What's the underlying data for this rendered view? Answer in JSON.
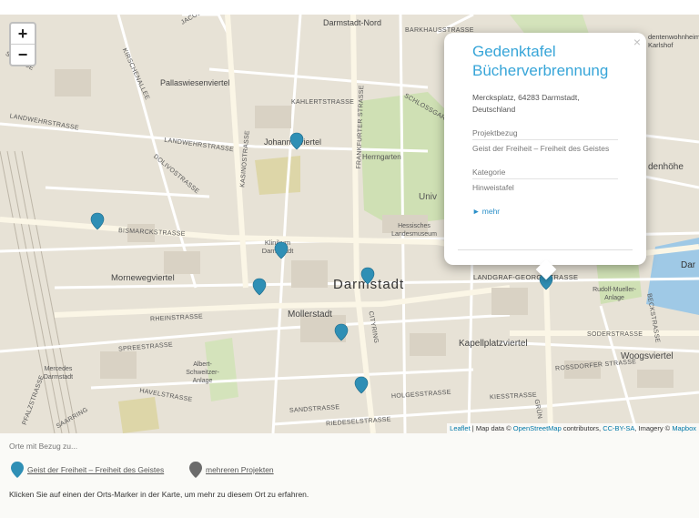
{
  "map": {
    "zoom_in": "+",
    "zoom_out": "−",
    "labels": {
      "darmstadt_nord": "Darmstadt-Nord",
      "barkhausstrasse": "BARKHAUSSTRASSE",
      "pallaswiesenviertel": "Pallaswiesenviertel",
      "kahlertstrasse": "KAHLERTSTRASSE",
      "landwehrstrasse": "LANDWEHRSTRASSE",
      "landwehrstrasse2": "LANDWEHRSTRASSE",
      "dolivostrasse": "DOLIVOSTRASSE",
      "kasinostrasse": "KASINOSTRASSE",
      "johannesviertel": "Johannesviertel",
      "frankfurter": "FRANKFURTER STRASSE",
      "herrngarten": "Herrngarten",
      "schlossgarten": "SCHLOSSGARTEN",
      "univ": "Univ",
      "landesmuseum": "Hessisches Landesmuseum",
      "bismarckstrasse": "BISMARCKSTRASSE",
      "klinikum": "Klinikum Darmstadt",
      "mornewegviertel": "Mornewegviertel",
      "darmstadt": "Darmstadt",
      "rheinstrasse": "RHEINSTRASSE",
      "mollerstadt": "Mollerstadt",
      "citypring": "CITYRING",
      "spreestrasse": "SPREESTRASSE",
      "mercedes": "Mercedes Darmstadt",
      "albert": "Albert-Schweitzer-Anlage",
      "havelstrasse": "HAVELSTRASSE",
      "sandstrasse": "SANDSTRASSE",
      "riedeselstrasse": "RIEDESELSTRASSE",
      "holgesstrasse": "HOLGESSTRASSE",
      "landgraf": "LANDGRAF-GEORG-STRASSE",
      "kapellplatz": "Kapellplatzviertel",
      "soderstrasse": "SODERSTRASSE",
      "woogsviertel": "Woogsviertel",
      "rossdorfer": "ROSSDORFER STRASSE",
      "kiesstrasse": "KIESSTRASSE",
      "rudolf": "Rudolf-Mueller-Anlage",
      "dentenwohnheim": "dentenwohnheim Karlshof",
      "denhoehe": "denhöhe",
      "dar": "Dar",
      "kirschenallee": "KIRSCHENALLEE",
      "pfalzstrasse": "PFALZSTRASSE",
      "jacob": "JACOB",
      "strasse_left": "STRASSE",
      "saarstrasse": "SAARRING",
      "beckstrasse": "BECKSTRASSE",
      "grun": "GRÜN"
    }
  },
  "popup": {
    "close": "×",
    "title": "Gedenktafel Bücherverbrennung",
    "address": "Mercksplatz, 64283 Darmstadt, Deutschland",
    "project_label": "Projektbezug",
    "project_value": "Geist der Freiheit – Freiheit des Geistes",
    "category_label": "Kategorie",
    "category_value": "Hinweistafel",
    "more": "► mehr"
  },
  "attribution": {
    "leaflet": "Leaflet",
    "sep": " | Map data © ",
    "osm": "OpenStreetMap",
    "contrib": " contributors, ",
    "license": "CC-BY-SA",
    "imagery": ", Imagery © ",
    "mapbox": "Mapbox"
  },
  "legend": {
    "title": "Orte mit Bezug zu...",
    "item1": "Geist der Freiheit – Freiheit des Geistes",
    "item2": "mehreren Projekten",
    "hint": "Klicken Sie auf einen der Orts-Marker in der Karte, um mehr zu diesem Ort zu erfahren."
  },
  "colors": {
    "marker_blue": "#2f8fb5",
    "marker_grey": "#6b6b6b",
    "accent": "#37a5d8"
  }
}
